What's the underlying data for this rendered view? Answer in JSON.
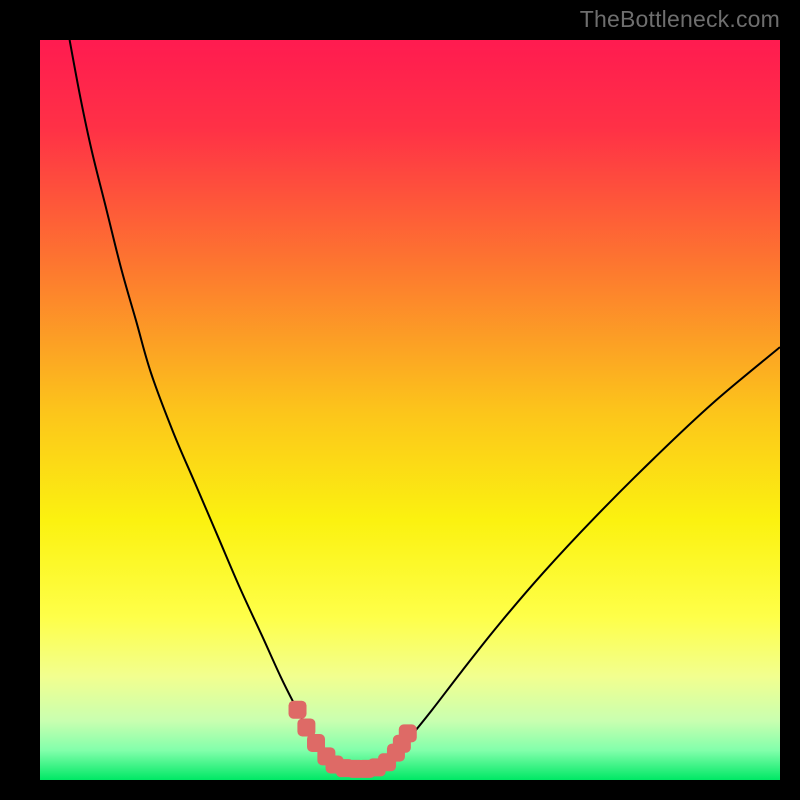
{
  "watermark": "TheBottleneck.com",
  "chart_data": {
    "type": "line",
    "title": "",
    "xlabel": "",
    "ylabel": "",
    "xlim": [
      0,
      100
    ],
    "ylim": [
      0,
      100
    ],
    "grid": false,
    "legend": false,
    "background_gradient": {
      "stops": [
        {
          "pos": 0.0,
          "color": "#ff1b50"
        },
        {
          "pos": 0.12,
          "color": "#ff3146"
        },
        {
          "pos": 0.3,
          "color": "#fd7530"
        },
        {
          "pos": 0.5,
          "color": "#fcc41b"
        },
        {
          "pos": 0.65,
          "color": "#fbf210"
        },
        {
          "pos": 0.78,
          "color": "#feff49"
        },
        {
          "pos": 0.86,
          "color": "#f2ff8f"
        },
        {
          "pos": 0.92,
          "color": "#c9ffb0"
        },
        {
          "pos": 0.96,
          "color": "#82ffab"
        },
        {
          "pos": 1.0,
          "color": "#00e865"
        }
      ]
    },
    "series": [
      {
        "name": "left-branch",
        "stroke": "#000000",
        "stroke_width": 2,
        "x": [
          4,
          5.5,
          7,
          9,
          11,
          13,
          15,
          18,
          21,
          24,
          27,
          30,
          32.5,
          34.5,
          36,
          37.5,
          38.7,
          39.5
        ],
        "y": [
          100,
          92,
          85,
          77,
          69,
          62,
          55,
          47,
          40,
          33,
          26,
          19.5,
          14,
          10,
          7.2,
          5,
          3.4,
          2.3
        ]
      },
      {
        "name": "right-branch",
        "stroke": "#000000",
        "stroke_width": 2,
        "x": [
          46.5,
          48,
          50,
          53,
          57,
          62,
          68,
          75,
          83,
          91,
          100
        ],
        "y": [
          2.3,
          3.6,
          5.8,
          9.5,
          14.7,
          21,
          28,
          35.5,
          43.5,
          51,
          58.5
        ]
      },
      {
        "name": "valley-markers",
        "type": "scatter",
        "stroke": "#de6a66",
        "fill": "#de6a66",
        "marker_radius_px": 9,
        "x": [
          34.8,
          36.0,
          37.3,
          38.7,
          39.8,
          41.2,
          42.7,
          44.1,
          45.5,
          46.9,
          48.1,
          48.9,
          49.7
        ],
        "y": [
          9.5,
          7.1,
          5.0,
          3.2,
          2.1,
          1.6,
          1.5,
          1.5,
          1.7,
          2.4,
          3.7,
          4.9,
          6.3
        ]
      }
    ]
  }
}
